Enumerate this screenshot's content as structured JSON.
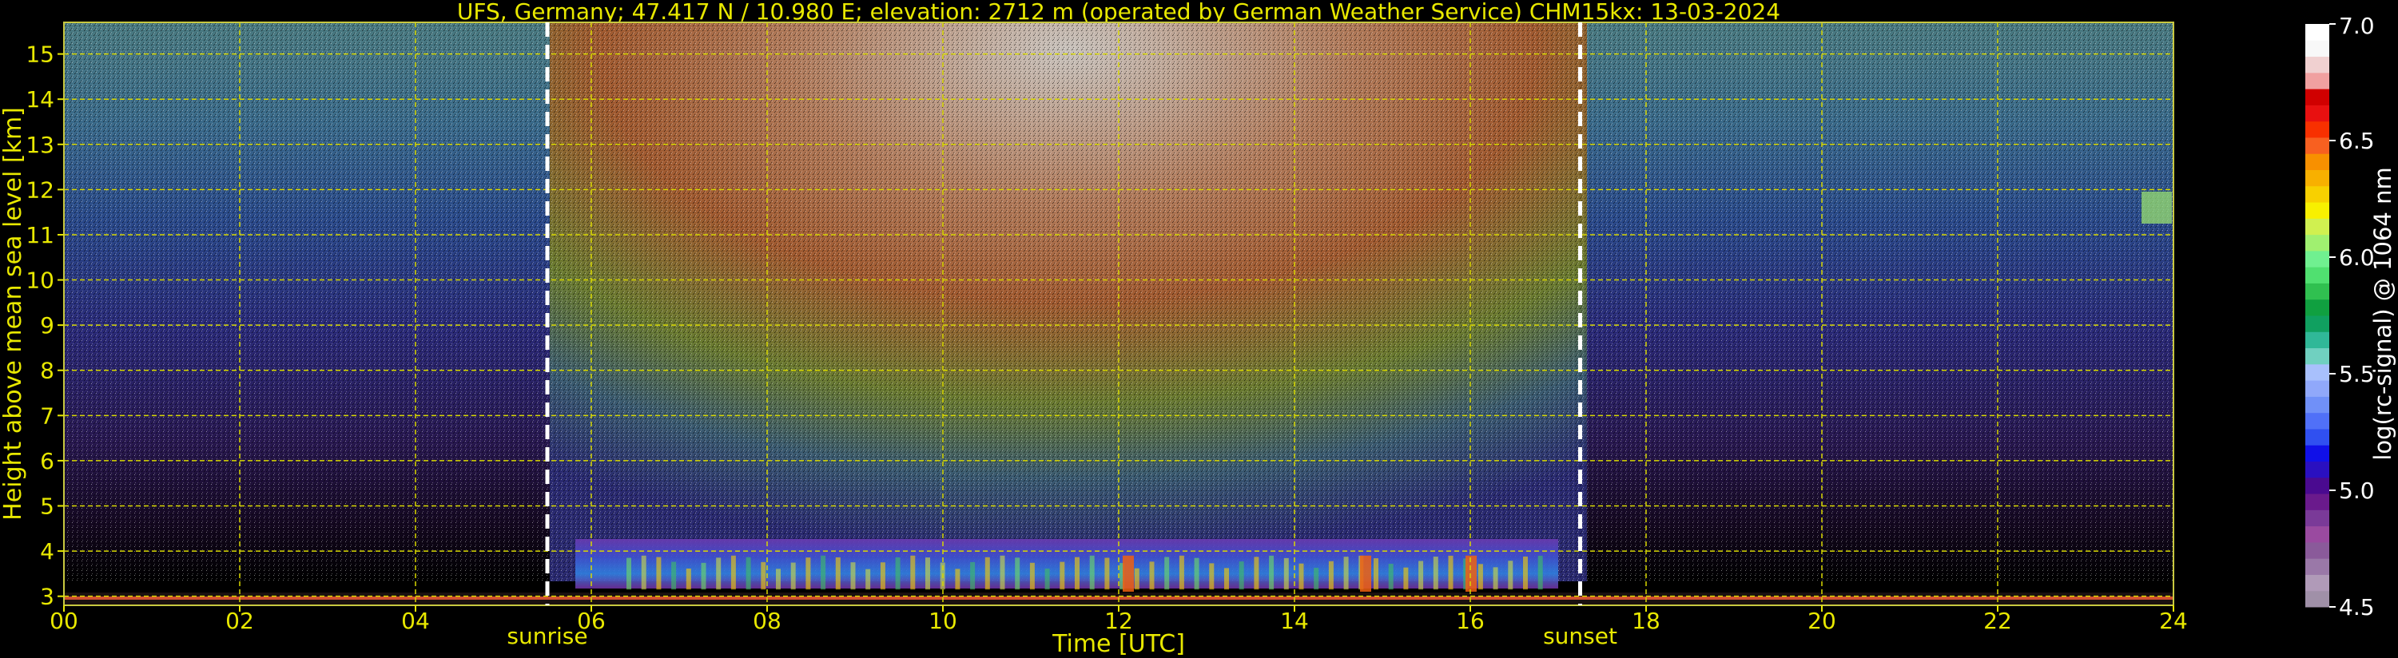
{
  "chart_data": {
    "type": "heatmap",
    "title": "UFS, Germany; 47.417 N / 10.980 E; elevation: 2712 m  (operated by German Weather Service)    CHM15kx: 13-03-2024",
    "xlabel": "Time [UTC]",
    "ylabel": "Height above mean sea level [km]",
    "xlim": [
      0,
      24
    ],
    "ylim": [
      2.8,
      15.7
    ],
    "x_ticks": [
      "00",
      "02",
      "04",
      "06",
      "08",
      "10",
      "12",
      "14",
      "16",
      "18",
      "20",
      "22",
      "24"
    ],
    "y_ticks": [
      "3",
      "4",
      "5",
      "6",
      "7",
      "8",
      "9",
      "10",
      "11",
      "12",
      "13",
      "14",
      "15"
    ],
    "grid": true,
    "events": [
      {
        "label": "sunrise",
        "time": 5.5
      },
      {
        "label": "sunset",
        "time": 17.25
      }
    ],
    "colorbar": {
      "label": "log(rc-signal) @ 1064 nm",
      "range": [
        4.5,
        7.0
      ],
      "ticks": [
        "4.5",
        "5.0",
        "5.5",
        "6.0",
        "6.5",
        "7.0"
      ],
      "colors": [
        "#a090a8",
        "#b09ab8",
        "#9a78a8",
        "#8a5a9a",
        "#9a4aa0",
        "#7a3a98",
        "#6a1a8c",
        "#4a0a90",
        "#2a10c0",
        "#1010e8",
        "#3050f0",
        "#5070f8",
        "#7090f8",
        "#90a8fa",
        "#a8c0fc",
        "#70d0c0",
        "#30b898",
        "#10a060",
        "#10a040",
        "#30c050",
        "#50e070",
        "#70f090",
        "#a0f070",
        "#d0f050",
        "#f8f000",
        "#f8d000",
        "#f8b000",
        "#f89000",
        "#f86020",
        "#f83000",
        "#e81010",
        "#d00000",
        "#f0a0a0",
        "#f0d0d0",
        "#f8f8f8",
        "#ffffff"
      ]
    },
    "observations": [
      {
        "feature": "background noise increasing during daylight",
        "from": 5.5,
        "to": 17.25
      },
      {
        "feature": "boundary layer aerosol",
        "from": 6.2,
        "to": 16.8,
        "height_km": [
          3.1,
          4.0
        ]
      },
      {
        "feature": "strong signal plumes",
        "times": [
          12.1,
          14.8,
          16.0
        ],
        "height_km": [
          3.1,
          3.9
        ]
      },
      {
        "feature": "thin cloud",
        "from": 23.4,
        "to": 24.0,
        "height_km": [
          11.3,
          11.8
        ]
      }
    ]
  }
}
